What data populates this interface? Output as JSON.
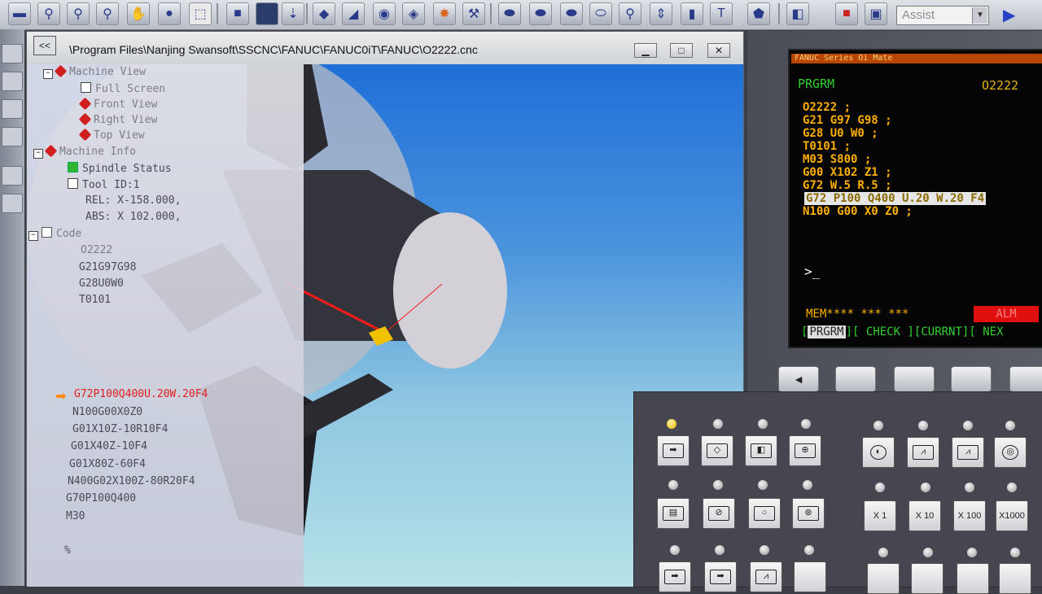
{
  "toolbar": {
    "icons": [
      "open-icon",
      "zoom-in-icon",
      "zoom-out-icon",
      "zoom-fit-icon",
      "pan-hand-icon",
      "rotate-globe-icon",
      "selection-box-icon",
      "blue-square-icon",
      "display-mode-icon",
      "file-down-icon",
      "workpiece-icon",
      "cutter-icon",
      "camera-icon",
      "coolant-icon",
      "spark-icon",
      "faucet-icon",
      "tool-capsule-icon",
      "tool-view-icon",
      "tool-display-icon",
      "tool-path-icon",
      "tool-holder-icon",
      "measure-icon",
      "tool-bar-icon",
      "t-tool-icon",
      "shield-icon",
      "record-icon",
      "save-icon",
      "window-icon"
    ],
    "assist_label": "Assist",
    "play_glyph": "▶"
  },
  "window": {
    "path": "\\Program Files\\Nanjing Swansoft\\SSCNC\\FANUC\\FANUC0iT\\FANUC\\O2222.cnc",
    "collapse_glyph": "<<",
    "minimize_glyph": "▁",
    "maximize_glyph": "□",
    "close_glyph": "✕"
  },
  "tree": {
    "items": [
      {
        "text": "Machine View",
        "style": "gray"
      },
      {
        "text": "Full Screen",
        "style": "gray"
      },
      {
        "text": "Front View",
        "style": "gray"
      },
      {
        "text": "Right View",
        "style": "gray"
      },
      {
        "text": "Top View",
        "style": "gray"
      },
      {
        "text": "Machine Info",
        "style": "gray"
      },
      {
        "text": "Spindle Status",
        "style": "dim"
      },
      {
        "text": "Tool ID:1",
        "style": "dim"
      },
      {
        "text": "REL: X-158.000,",
        "style": "dim"
      },
      {
        "text": "ABS: X 102.000,",
        "style": "dim"
      },
      {
        "text": "Code",
        "style": "gray"
      },
      {
        "text": "O2222",
        "style": "gray"
      },
      {
        "text": "G21G97G98",
        "style": "dim"
      },
      {
        "text": "G28U0W0",
        "style": "dim"
      },
      {
        "text": "T0101",
        "style": "dim"
      },
      {
        "text": "G72P100Q400U.20W.20F4",
        "style": "active"
      },
      {
        "text": "N100G00X0Z0",
        "style": "dim"
      },
      {
        "text": "G01X10Z-10R10F4",
        "style": "dim"
      },
      {
        "text": "G01X40Z-10F4",
        "style": "dim"
      },
      {
        "text": "G01X80Z-60F4",
        "style": "dim"
      },
      {
        "text": "N400G02X100Z-80R20F4",
        "style": "dim"
      },
      {
        "text": "G70P100Q400",
        "style": "dim"
      },
      {
        "text": "M30",
        "style": "dim"
      },
      {
        "text": "%",
        "style": "dim"
      }
    ]
  },
  "cnc": {
    "header": "FANUC Series Oi Mate",
    "mode": "PRGRM",
    "program_number": "O2222",
    "code_lines": [
      "O2222 ;",
      "G21 G97 G98 ;",
      "G28 U0 W0 ;",
      "T0101 ;",
      "M03 S800 ;",
      "G00 X102 Z1 ;",
      "G72 W.5 R.5 ;",
      "G72 P100 Q400 U.20 W.20 F4",
      "N100 G00 X0 Z0 ;"
    ],
    "highlighted_line": 7,
    "prompt": ">_",
    "status": "MEM**** ***   ***",
    "alarm": "ALM",
    "softkeys": [
      "PRGRM",
      "CHECK",
      "CURRNT",
      "NEX"
    ],
    "softkey_buttons": [
      "◄",
      "",
      "",
      "",
      ""
    ]
  },
  "keypad": {
    "mode_keys": [
      "auto-mode-icon",
      "edit-mode-icon",
      "mdi-mode-icon",
      "dnc-mode-icon",
      "reference-mode-icon",
      "jog-mode-icon",
      "inc-jog-mode-icon",
      "handwheel-mode-icon"
    ],
    "function_keys": [
      "single-block-icon",
      "block-skip-icon",
      "optional-stop-icon",
      "manual-program-icon"
    ],
    "step_keys": [
      "X 1",
      "X 10",
      "X 100",
      "X1000"
    ],
    "bottom_keys": [
      "machine-lock-icon",
      "dry-run-icon",
      "feed-hold-icon",
      "",
      "",
      "",
      "",
      ""
    ]
  }
}
